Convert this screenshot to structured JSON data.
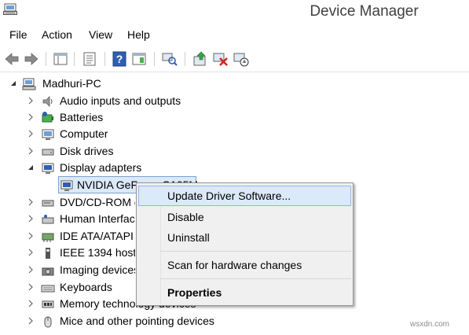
{
  "window": {
    "title": "Device Manager"
  },
  "menu": {
    "file": "File",
    "action": "Action",
    "view": "View",
    "help": "Help"
  },
  "toolbar": {
    "buttons": [
      "back-icon",
      "forward-icon",
      "show-hide-console-tree-icon",
      "properties-icon",
      "help-icon",
      "action-pane-icon",
      "scan-hardware-icon",
      "update-driver-icon",
      "uninstall-device-icon",
      "disable-device-icon"
    ]
  },
  "tree": {
    "root": "Madhuri-PC",
    "items": [
      {
        "label": "Audio inputs and outputs",
        "icon": "speaker-icon"
      },
      {
        "label": "Batteries",
        "icon": "battery-icon"
      },
      {
        "label": "Computer",
        "icon": "computer-icon"
      },
      {
        "label": "Disk drives",
        "icon": "disk-drive-icon"
      },
      {
        "label": "Display adapters",
        "icon": "monitor-icon",
        "expanded": true
      },
      {
        "label": "NVIDIA GeForce G105M",
        "icon": "monitor-icon",
        "selected": true
      },
      {
        "label": "DVD/CD-ROM drives",
        "icon": "dvd-icon"
      },
      {
        "label": "Human Interface Devices",
        "icon": "hid-icon"
      },
      {
        "label": "IDE ATA/ATAPI controllers",
        "icon": "ide-icon"
      },
      {
        "label": "IEEE 1394 host controllers",
        "icon": "firewire-icon"
      },
      {
        "label": "Imaging devices",
        "icon": "camera-icon"
      },
      {
        "label": "Keyboards",
        "icon": "keyboard-icon"
      },
      {
        "label": "Memory technology devices",
        "icon": "memory-icon"
      },
      {
        "label": "Mice and other pointing devices",
        "icon": "mouse-icon"
      }
    ]
  },
  "context_menu": {
    "update_driver": "Update Driver Software...",
    "disable": "Disable",
    "uninstall": "Uninstall",
    "scan": "Scan for hardware changes",
    "properties": "Properties"
  },
  "watermark": "wsxdn.com"
}
